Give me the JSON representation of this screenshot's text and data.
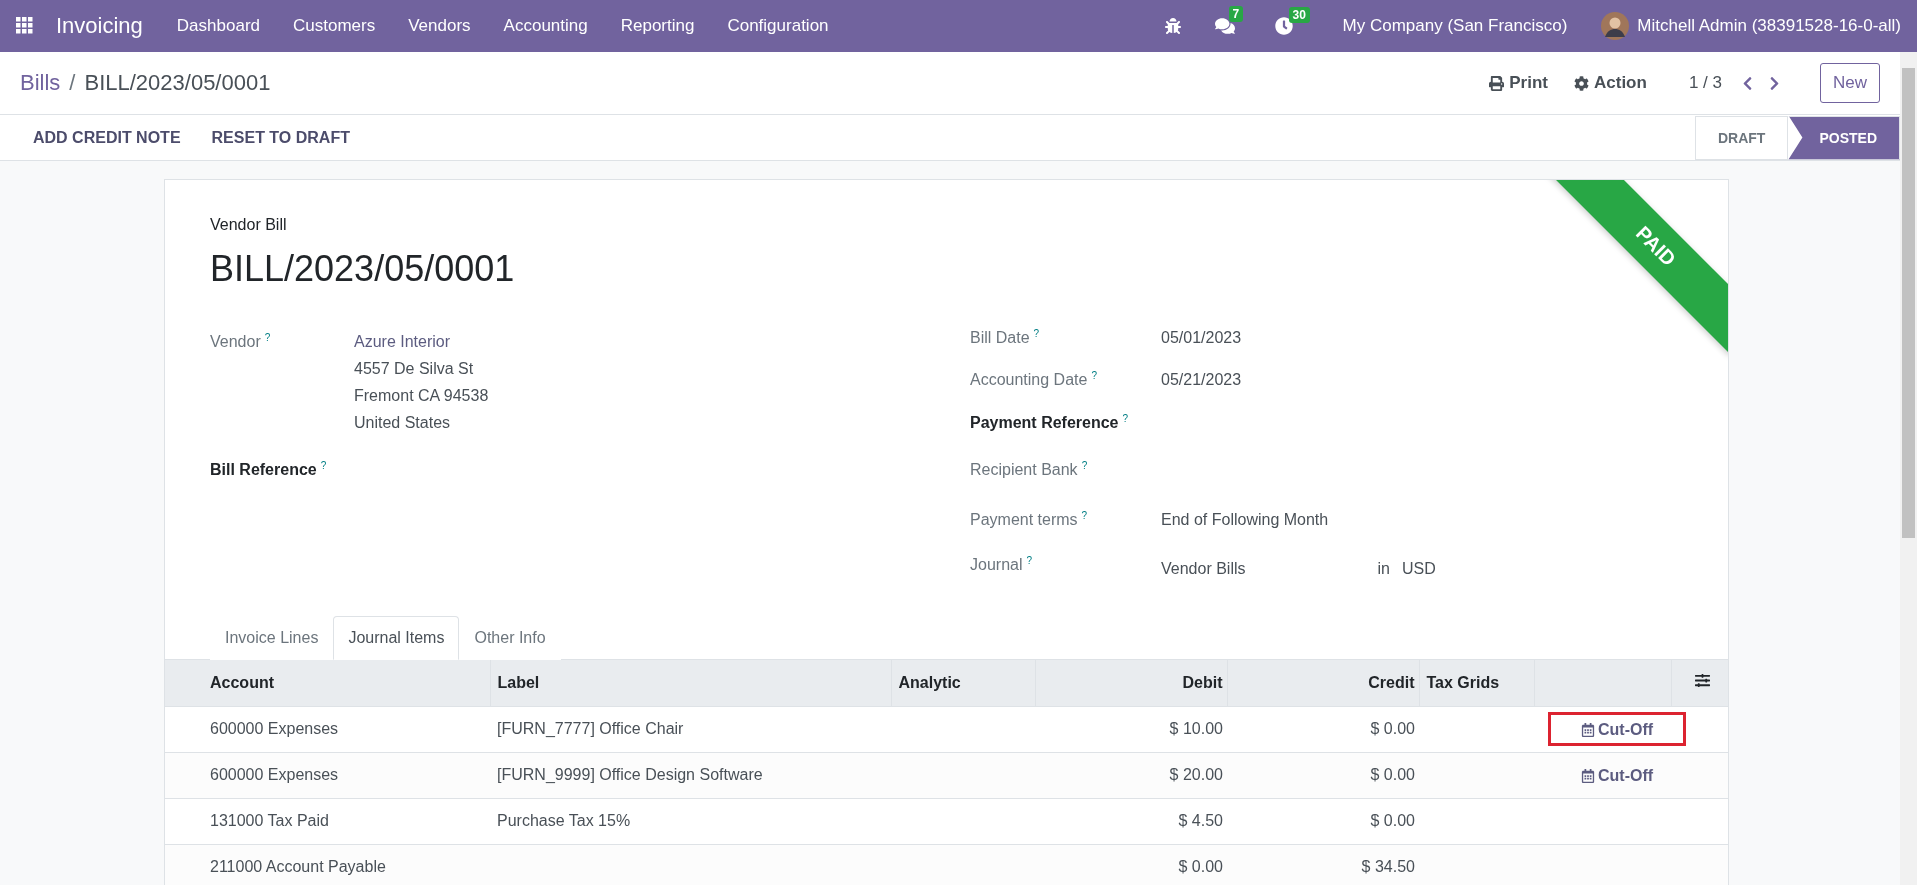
{
  "navbar": {
    "app_name": "Invoicing",
    "menu": [
      "Dashboard",
      "Customers",
      "Vendors",
      "Accounting",
      "Reporting",
      "Configuration"
    ],
    "messages_count": "7",
    "activities_count": "30",
    "company": "My Company (San Francisco)",
    "user": "Mitchell Admin (38391528-16-0-all)"
  },
  "control_panel": {
    "breadcrumb": [
      {
        "label": "Bills"
      },
      {
        "label": "BILL/2023/05/0001"
      }
    ],
    "separator": "/",
    "print": "Print",
    "action": "Action",
    "pager": "1 / 3",
    "new_button": "New"
  },
  "action_bar": {
    "buttons": [
      "ADD CREDIT NOTE",
      "RESET TO DRAFT"
    ],
    "statuses": [
      {
        "label": "DRAFT",
        "selected": false
      },
      {
        "label": "POSTED",
        "selected": true
      }
    ]
  },
  "form": {
    "ribbon": "PAID",
    "subtitle": "Vendor Bill",
    "title": "BILL/2023/05/0001",
    "left_fields": [
      {
        "label": "Vendor",
        "emphasized": false,
        "value_lines": [
          "Azure Interior",
          "4557 De Silva St",
          "Fremont CA 94538",
          "United States"
        ]
      },
      {
        "label": "Bill Reference",
        "emphasized": true
      }
    ],
    "right_fields": [
      {
        "label": "Bill Date",
        "emphasized": false,
        "value": "05/01/2023"
      },
      {
        "label": "Accounting Date",
        "emphasized": false,
        "value": "05/21/2023"
      },
      {
        "label": "Payment Reference",
        "emphasized": true
      },
      {
        "label": "Recipient Bank",
        "emphasized": false
      },
      {
        "label": "Payment terms",
        "emphasized": false,
        "value": "End of Following Month"
      },
      {
        "label": "Journal",
        "emphasized": false,
        "value": "Vendor Bills",
        "connector": "in",
        "currency": "USD"
      }
    ],
    "help_mark": "?",
    "tabs": [
      {
        "label": "Invoice Lines",
        "selected": false
      },
      {
        "label": "Journal Items",
        "selected": true
      },
      {
        "label": "Other Info",
        "selected": false
      }
    ],
    "table": {
      "columns": [
        "Account",
        "Label",
        "Analytic",
        "Debit",
        "Credit",
        "Tax Grids"
      ],
      "rows": [
        {
          "account": "600000 Expenses",
          "label": "[FURN_7777] Office Chair",
          "debit": "$ 10.00",
          "credit": "$ 0.00",
          "cutoff": {
            "label": "Cut-Off",
            "highlighted": true
          }
        },
        {
          "account": "600000 Expenses",
          "label": "[FURN_9999] Office Design Software",
          "debit": "$ 20.00",
          "credit": "$ 0.00",
          "cutoff": {
            "label": "Cut-Off",
            "highlighted": false
          }
        },
        {
          "account": "131000 Tax Paid",
          "label": "Purchase Tax 15%",
          "debit": "$ 4.50",
          "credit": "$ 0.00"
        },
        {
          "account": "211000 Account Payable",
          "debit": "$ 0.00",
          "credit": "$ 34.50"
        }
      ]
    }
  }
}
